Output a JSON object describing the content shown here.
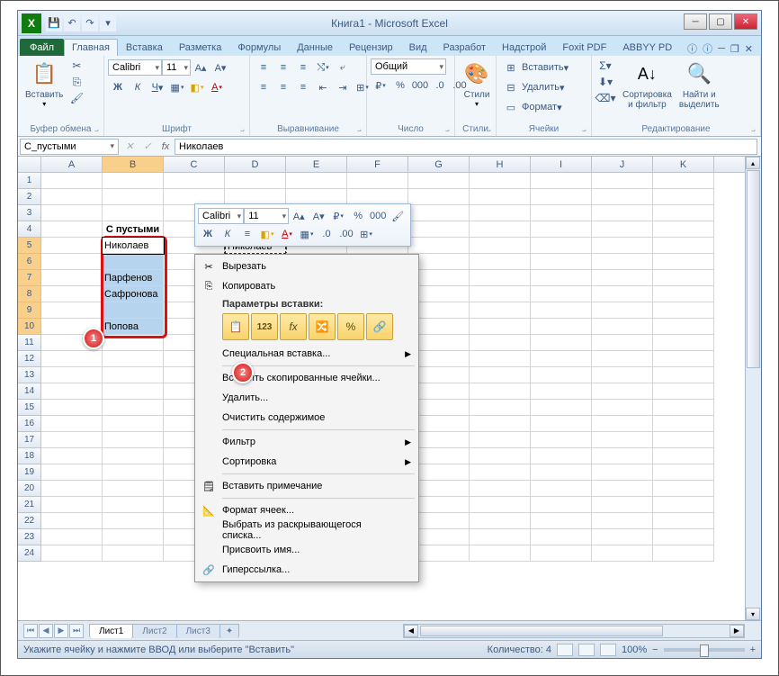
{
  "title": "Книга1 - Microsoft Excel",
  "tabs": {
    "file": "Файл",
    "home": "Главная",
    "insert": "Вставка",
    "layout": "Разметка",
    "formulas": "Формулы",
    "data": "Данные",
    "review": "Рецензир",
    "view": "Вид",
    "developer": "Разработ",
    "addins": "Надстрой",
    "foxit": "Foxit PDF",
    "abbyy": "ABBYY PD"
  },
  "groups": {
    "clipboard": "Буфер обмена",
    "font": "Шрифт",
    "align": "Выравнивание",
    "number": "Число",
    "styles": "Стили",
    "cells": "Ячейки",
    "editing": "Редактирование"
  },
  "btns": {
    "paste": "Вставить",
    "styles": "Стили",
    "insert": "Вставить",
    "delete": "Удалить",
    "format": "Формат",
    "sort": "Сортировка\nи фильтр",
    "find": "Найти и\nвыделить"
  },
  "font": {
    "name": "Calibri",
    "size": "11",
    "format": "Общий"
  },
  "namebox": "С_пустыми",
  "formula": "Николаев",
  "cols": [
    "A",
    "B",
    "C",
    "D",
    "E",
    "F",
    "G",
    "H",
    "I",
    "J",
    "K"
  ],
  "rows": 24,
  "data": {
    "b4": "С пустыми",
    "b5": "Николаев",
    "b7": "Парфенов",
    "b8": "Сафронова",
    "b10": "Попова",
    "d5": "Николаев"
  },
  "mini": {
    "font": "Calibri",
    "size": "11"
  },
  "ctx": {
    "cut": "Вырезать",
    "copy": "Копировать",
    "pasteopts": "Параметры вставки:",
    "pastespecial": "Специальная вставка...",
    "insertcells": "Вставить скопированные ячейки...",
    "del": "Удалить...",
    "clear": "Очистить содержимое",
    "filter": "Фильтр",
    "sort": "Сортировка",
    "comment": "Вставить примечание",
    "fmt": "Формат ячеек...",
    "pick": "Выбрать из раскрывающегося списка...",
    "name": "Присвоить имя...",
    "link": "Гиперссылка..."
  },
  "pasteicons": [
    "📋",
    "123",
    "fx",
    "🔀",
    "%",
    "🔗"
  ],
  "sheets": [
    "Лист1",
    "Лист2",
    "Лист3"
  ],
  "status": {
    "msg": "Укажите ячейку и нажмите ВВОД или выберите \"Вставить\"",
    "count": "Количество: 4",
    "zoom": "100%"
  }
}
